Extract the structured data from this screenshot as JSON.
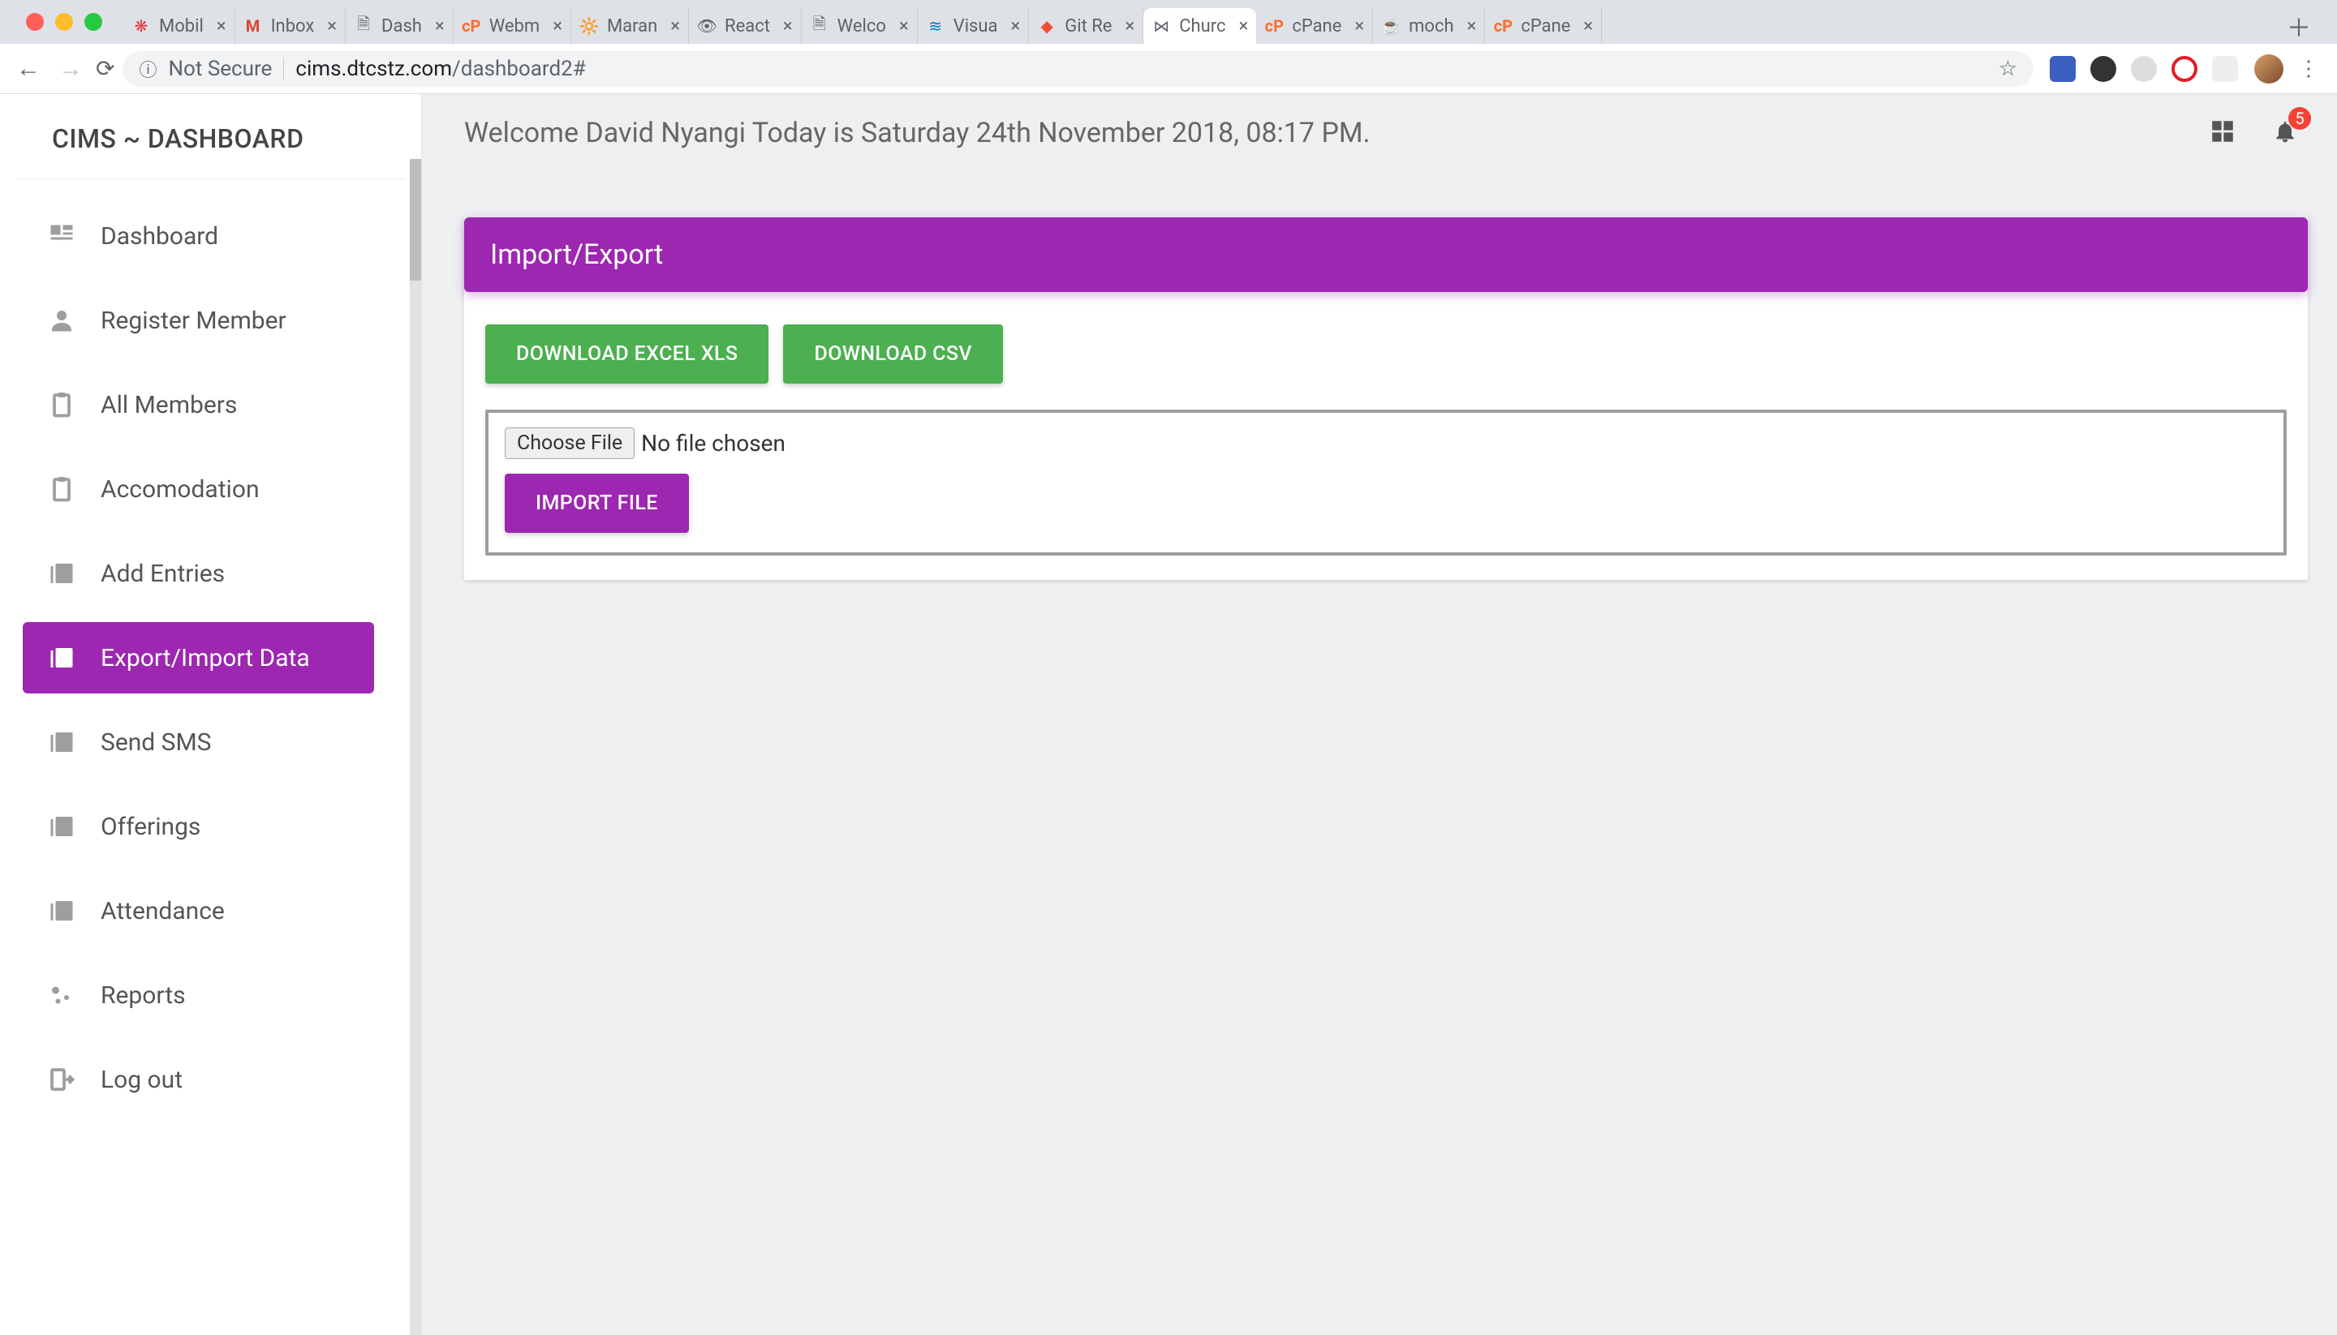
{
  "browser": {
    "not_secure": "Not Secure",
    "url_domain": "cims.dtcstz.com",
    "url_path": "/dashboard2#",
    "tabs": [
      {
        "label": "Mobil"
      },
      {
        "label": "Inbox"
      },
      {
        "label": "Dash"
      },
      {
        "label": "Webm"
      },
      {
        "label": "Maran"
      },
      {
        "label": "React"
      },
      {
        "label": "Welco"
      },
      {
        "label": "Visua"
      },
      {
        "label": "Git Re"
      },
      {
        "label": "Churc"
      },
      {
        "label": "cPane"
      },
      {
        "label": "moch"
      },
      {
        "label": "cPane"
      }
    ]
  },
  "sidebar": {
    "brand": "CIMS ~ DASHBOARD",
    "items": [
      {
        "label": "Dashboard"
      },
      {
        "label": "Register Member"
      },
      {
        "label": "All Members"
      },
      {
        "label": "Accomodation"
      },
      {
        "label": "Add Entries"
      },
      {
        "label": "Export/Import Data"
      },
      {
        "label": "Send SMS"
      },
      {
        "label": "Offerings"
      },
      {
        "label": "Attendance"
      },
      {
        "label": "Reports"
      },
      {
        "label": "Log out"
      }
    ]
  },
  "header": {
    "welcome": "Welcome David Nyangi Today is Saturday 24th November 2018, 08:17 PM.",
    "badge": "5"
  },
  "panel": {
    "title": "Import/Export",
    "download_xls": "DOWNLOAD EXCEL XLS",
    "download_csv": "DOWNLOAD CSV",
    "choose_file": "Choose File",
    "no_file": "No file chosen",
    "import_btn": "IMPORT FILE"
  }
}
